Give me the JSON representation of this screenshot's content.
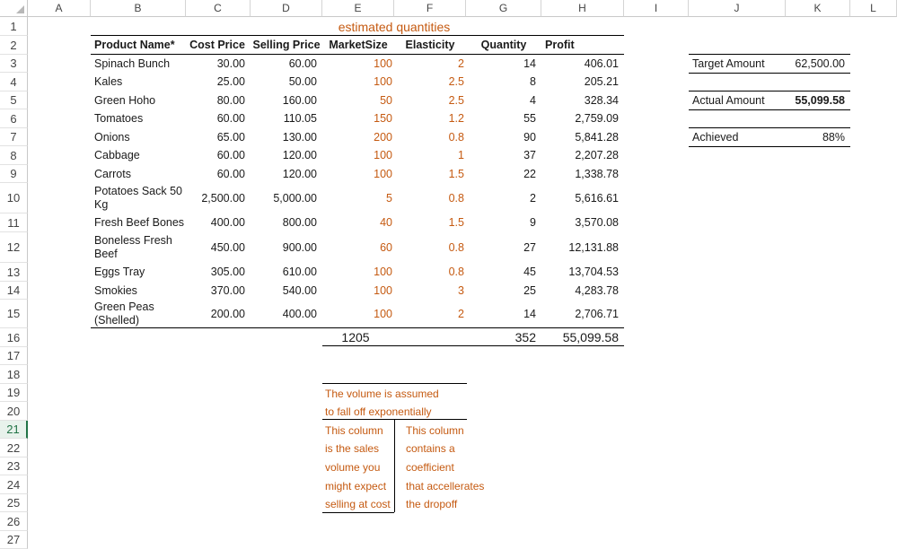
{
  "columns": [
    "A",
    "B",
    "C",
    "D",
    "E",
    "F",
    "G",
    "H",
    "I",
    "J",
    "K",
    "L"
  ],
  "rows": [
    "1",
    "2",
    "3",
    "4",
    "5",
    "6",
    "7",
    "8",
    "9",
    "10",
    "11",
    "12",
    "13",
    "14",
    "15",
    "16",
    "17",
    "18",
    "19",
    "20",
    "21",
    "22",
    "23",
    "24",
    "25",
    "26",
    "27"
  ],
  "active_row": "21",
  "title": "estimated quantities",
  "headers": {
    "product": "Product Name*",
    "cost": "Cost Price",
    "selling": "Selling Price",
    "market": "MarketSize",
    "elasticity": "Elasticity",
    "quantity": "Quantity",
    "profit": "Profit"
  },
  "products": [
    {
      "name": "Spinach Bunch",
      "cost": "30.00",
      "selling": "60.00",
      "market": "100",
      "elasticity": "2",
      "quantity": "14",
      "profit": "406.01"
    },
    {
      "name": "Kales",
      "cost": "25.00",
      "selling": "50.00",
      "market": "100",
      "elasticity": "2.5",
      "quantity": "8",
      "profit": "205.21"
    },
    {
      "name": "Green Hoho",
      "cost": "80.00",
      "selling": "160.00",
      "market": "50",
      "elasticity": "2.5",
      "quantity": "4",
      "profit": "328.34"
    },
    {
      "name": "Tomatoes",
      "cost": "60.00",
      "selling": "110.05",
      "market": "150",
      "elasticity": "1.2",
      "quantity": "55",
      "profit": "2,759.09"
    },
    {
      "name": "Onions",
      "cost": "65.00",
      "selling": "130.00",
      "market": "200",
      "elasticity": "0.8",
      "quantity": "90",
      "profit": "5,841.28"
    },
    {
      "name": "Cabbage",
      "cost": "60.00",
      "selling": "120.00",
      "market": "100",
      "elasticity": "1",
      "quantity": "37",
      "profit": "2,207.28"
    },
    {
      "name": "Carrots",
      "cost": "60.00",
      "selling": "120.00",
      "market": "100",
      "elasticity": "1.5",
      "quantity": "22",
      "profit": "1,338.78"
    },
    {
      "name": "Potatoes Sack 50 Kg",
      "cost": "2,500.00",
      "selling": "5,000.00",
      "market": "5",
      "elasticity": "0.8",
      "quantity": "2",
      "profit": "5,616.61"
    },
    {
      "name": "Fresh Beef Bones",
      "cost": "400.00",
      "selling": "800.00",
      "market": "40",
      "elasticity": "1.5",
      "quantity": "9",
      "profit": "3,570.08"
    },
    {
      "name": "Boneless Fresh Beef",
      "cost": "450.00",
      "selling": "900.00",
      "market": "60",
      "elasticity": "0.8",
      "quantity": "27",
      "profit": "12,131.88"
    },
    {
      "name": "Eggs Tray",
      "cost": "305.00",
      "selling": "610.00",
      "market": "100",
      "elasticity": "0.8",
      "quantity": "45",
      "profit": "13,704.53"
    },
    {
      "name": "Smokies",
      "cost": "370.00",
      "selling": "540.00",
      "market": "100",
      "elasticity": "3",
      "quantity": "25",
      "profit": "4,283.78"
    },
    {
      "name": "Green Peas (Shelled)",
      "cost": "200.00",
      "selling": "400.00",
      "market": "100",
      "elasticity": "2",
      "quantity": "14",
      "profit": "2,706.71"
    }
  ],
  "totals": {
    "market": "1205",
    "quantity": "352",
    "profit": "55,099.58"
  },
  "summary": {
    "target_label": "Target Amount",
    "target_value": "62,500.00",
    "actual_label": "Actual Amount",
    "actual_value": "55,099.58",
    "achieved_label": "Achieved",
    "achieved_value": "88%"
  },
  "notes": {
    "top_line1": "The volume is assumed",
    "top_line2": "to fall off exponentially",
    "left": [
      "This column",
      "is the sales",
      "volume you",
      "might expect",
      "selling at cost"
    ],
    "right": [
      "This column",
      "contains a",
      "coefficient",
      "that accellerates",
      "the dropoff"
    ]
  },
  "colors": {
    "accent_orange": "#c55a11",
    "excel_green": "#217346"
  }
}
